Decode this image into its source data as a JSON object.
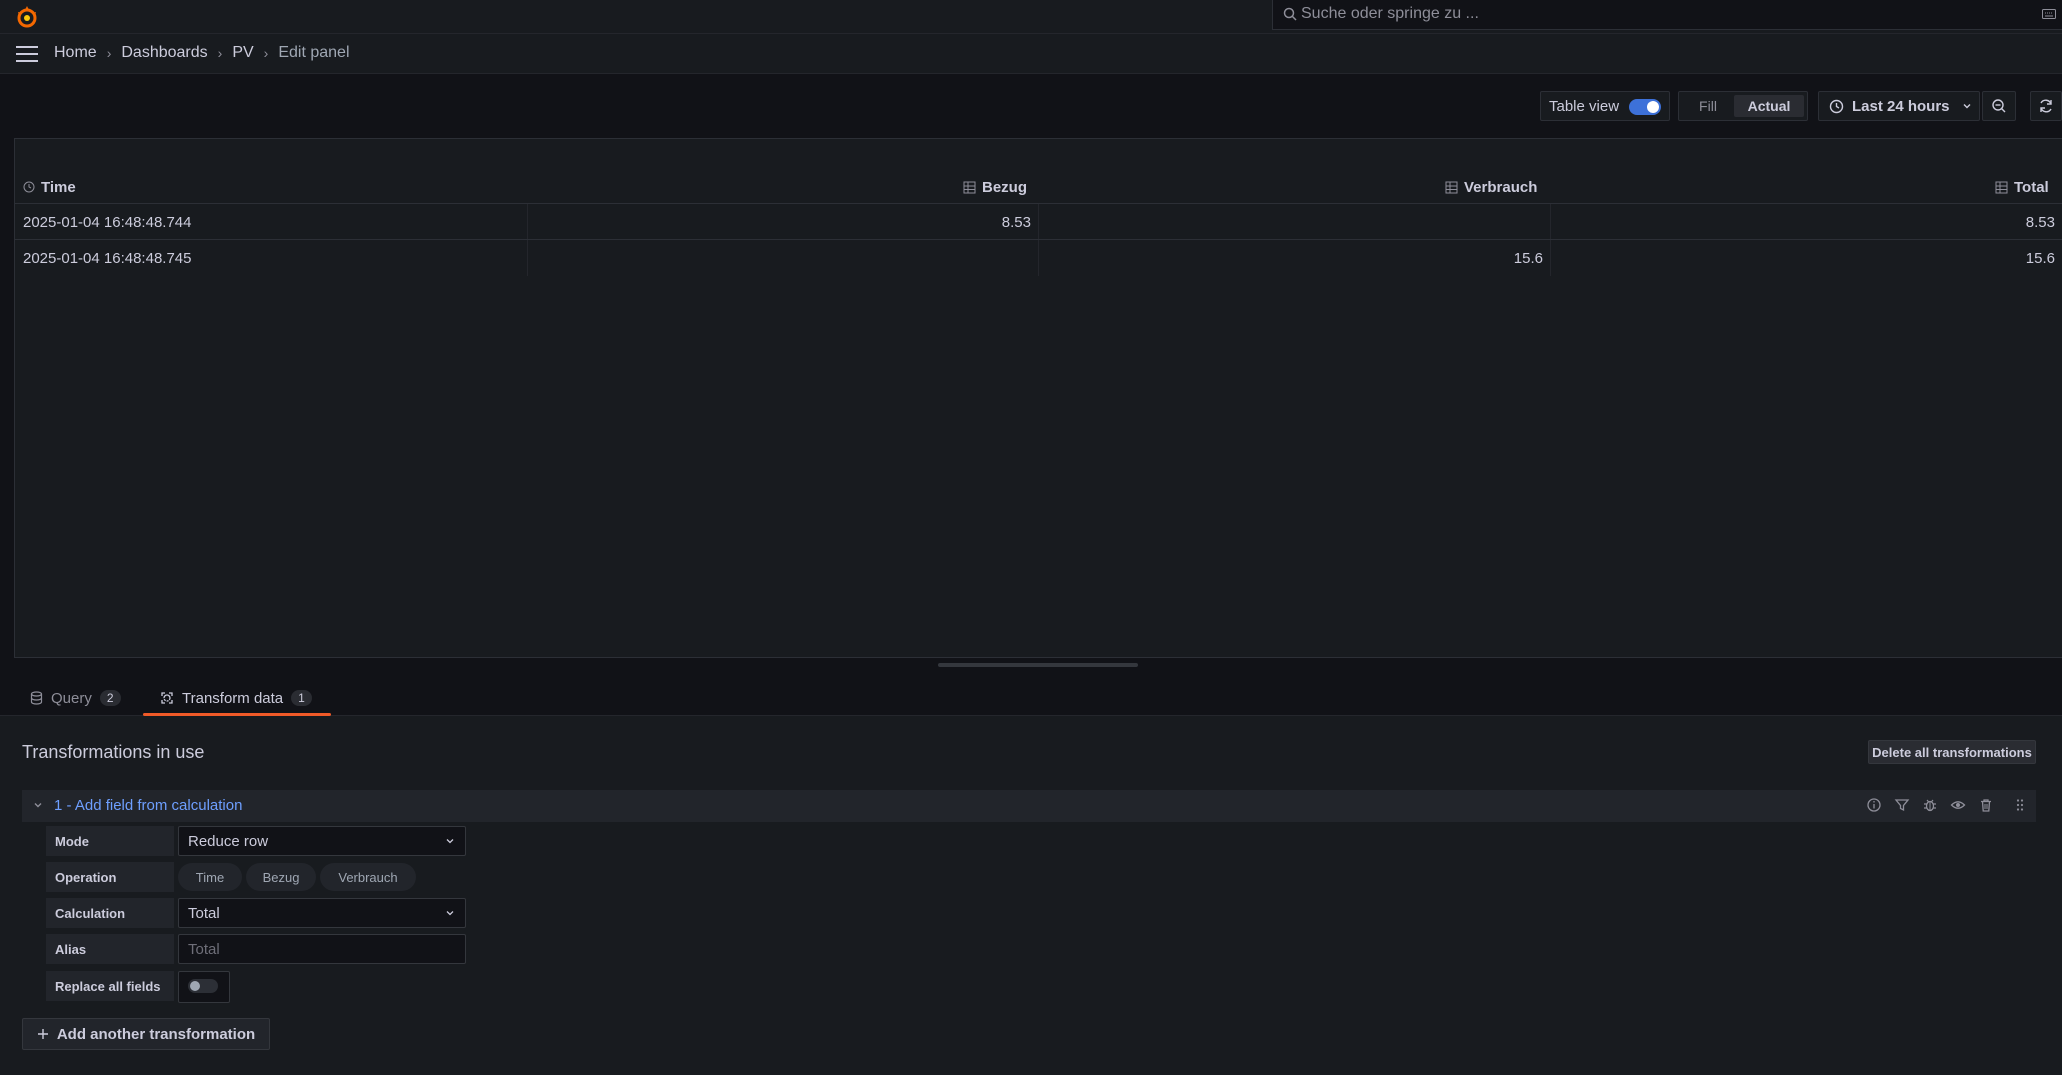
{
  "app": {
    "search_placeholder": "Suche oder springe zu ...",
    "brand_color": "#f46800"
  },
  "breadcrumb": {
    "items": [
      "Home",
      "Dashboards",
      "PV"
    ],
    "current": "Edit panel",
    "separator": "›"
  },
  "toolbar": {
    "table_view_label": "Table view",
    "table_view_on": true,
    "fill_label": "Fill",
    "actual_label": "Actual",
    "time_range_label": "Last 24 hours"
  },
  "table": {
    "columns": [
      "Time",
      "Bezug",
      "Verbrauch",
      "Total"
    ],
    "rows": [
      [
        "2025-01-04 16:48:48.744",
        "8.53",
        "",
        "8.53"
      ],
      [
        "2025-01-04 16:48:48.745",
        "",
        "15.6",
        "15.6"
      ]
    ]
  },
  "tabs": {
    "query": {
      "label": "Query",
      "count": "2"
    },
    "transform": {
      "label": "Transform data",
      "count": "1"
    }
  },
  "transformations": {
    "heading": "Transformations in use",
    "delete_all_label": "Delete all transformations",
    "item_title": "1 - Add field from calculation",
    "fields": {
      "mode_label": "Mode",
      "mode_value": "Reduce row",
      "operation_label": "Operation",
      "operation_options": [
        "Time",
        "Bezug",
        "Verbrauch"
      ],
      "calculation_label": "Calculation",
      "calculation_value": "Total",
      "alias_label": "Alias",
      "alias_placeholder": "Total",
      "replace_label": "Replace all fields",
      "replace_on": false
    },
    "add_label": "Add another transformation"
  },
  "colors": {
    "accent_blue": "#3d71d9",
    "tab_underline": "#f05a28",
    "link_blue": "#6e9fff"
  }
}
